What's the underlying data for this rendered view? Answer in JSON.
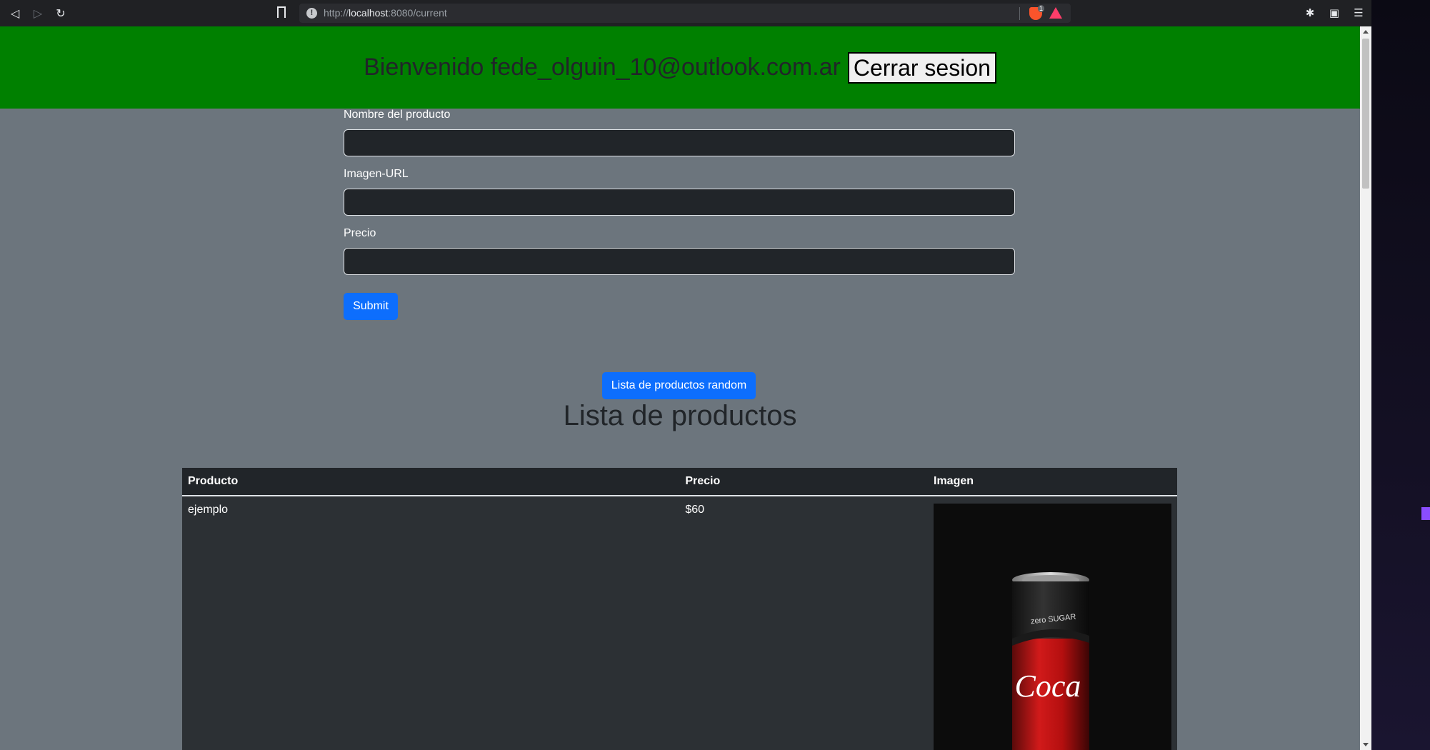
{
  "browser": {
    "url_scheme": "http://",
    "url_host": "localhost",
    "url_rest": ":8080/current",
    "shield_count": "1",
    "icons": [
      "back-icon",
      "forward-icon",
      "reload-icon",
      "bookmark-icon",
      "info-icon",
      "brave-shield-icon",
      "bat-rewards-icon",
      "extensions-icon",
      "wallet-icon",
      "menu-icon"
    ]
  },
  "header": {
    "welcome": "Bienvenido fede_olguin_10@outlook.com.ar",
    "logout_label": "Cerrar sesion",
    "background": "#008000"
  },
  "form": {
    "name_label": "Nombre del producto",
    "name_value": "",
    "image_label": "Imagen-URL",
    "image_value": "",
    "price_label": "Precio",
    "price_value": "",
    "submit_label": "Submit"
  },
  "random_button_label": "Lista de productos random",
  "list_title": "Lista de productos",
  "table": {
    "headers": [
      "Producto",
      "Precio",
      "Imagen"
    ],
    "rows": [
      {
        "product": "ejemplo",
        "price": "$60",
        "image": "coca-cola-zero-can-photo"
      }
    ]
  },
  "colors": {
    "page_bg": "#6c757d",
    "primary": "#0d6efd",
    "table_bg": "#2c3034"
  }
}
